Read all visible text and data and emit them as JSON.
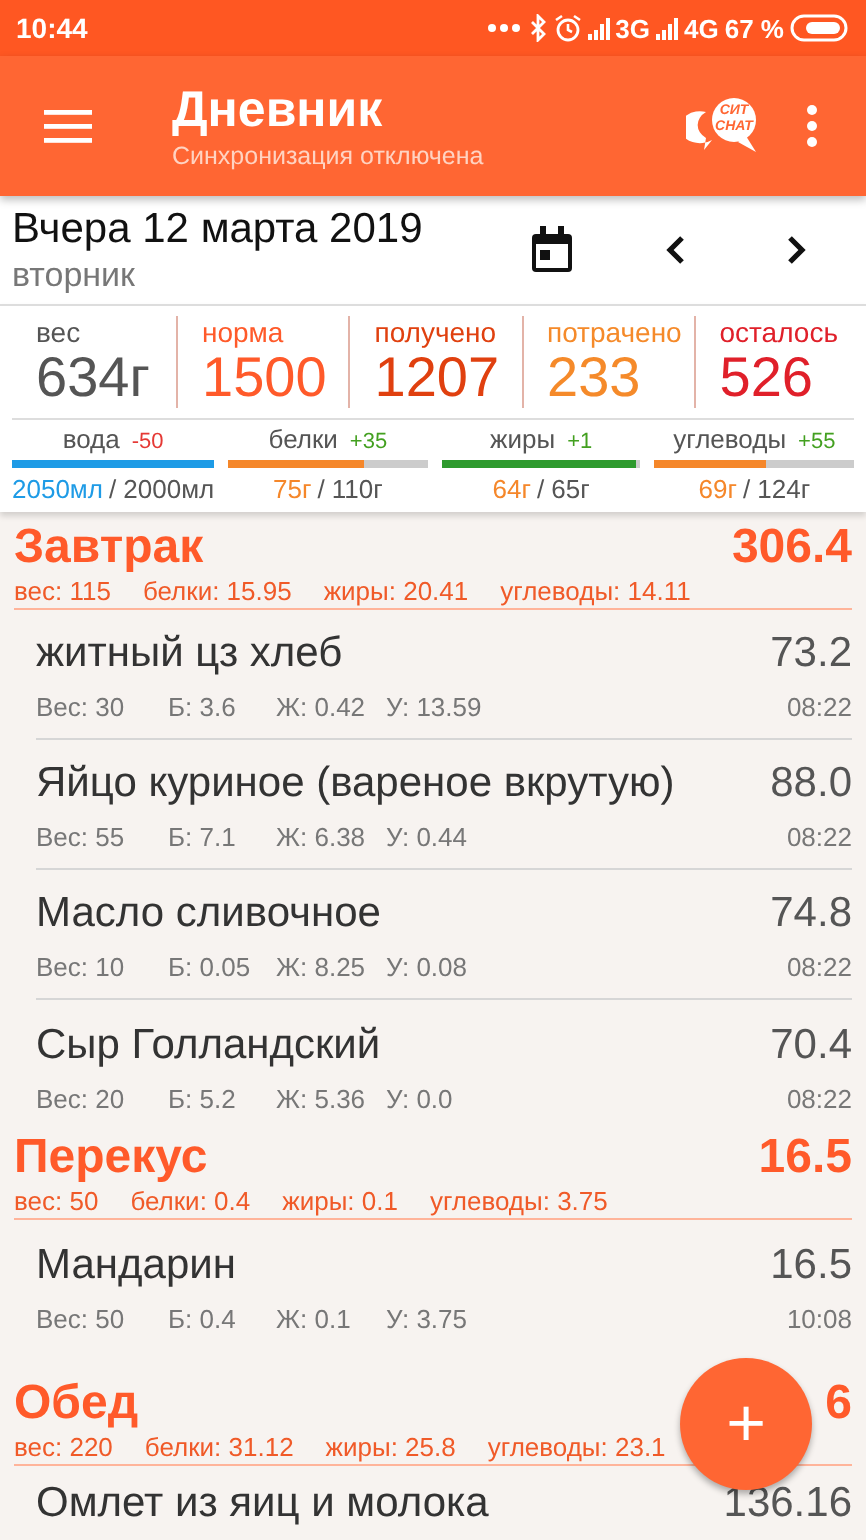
{
  "status_bar": {
    "time": "10:44",
    "network_1": "3G",
    "network_2": "4G",
    "battery": "67 %"
  },
  "app_bar": {
    "title": "Дневник",
    "subtitle": "Синхронизация отключена",
    "chat_badge": [
      "СИТ",
      "CHAT"
    ]
  },
  "date": {
    "title": "Вчера 12 марта 2019",
    "weekday": "вторник"
  },
  "summary": [
    {
      "label": "вес",
      "value": "634г",
      "color": "#555555"
    },
    {
      "label": "норма",
      "value": "1500",
      "color": "#ff5a2a"
    },
    {
      "label": "получено",
      "value": "1207",
      "color": "#e0400f"
    },
    {
      "label": "потрачено",
      "value": "233",
      "color": "#f58a2a"
    },
    {
      "label": "осталось",
      "value": "526",
      "color": "#e0202a"
    }
  ],
  "nutrients": [
    {
      "label": "вода",
      "delta": {
        "text": "-50",
        "color": "#e53935"
      },
      "current": "2050мл",
      "target": "/ 2000мл",
      "level": 1,
      "color": "#1e9be6"
    },
    {
      "label": "белки",
      "delta": {
        "text": "+35",
        "color": "#43a020"
      },
      "current": "75г",
      "target": "/ 110г",
      "level": 0.68,
      "color": "#f5872a"
    },
    {
      "label": "жиры",
      "delta": {
        "text": "+1",
        "color": "#43a020"
      },
      "current": "64г",
      "target": "/ 65г",
      "level": 0.98,
      "color": "#2e9a2e"
    },
    {
      "label": "углеводы",
      "delta": {
        "text": "+55",
        "color": "#43a020"
      },
      "current": "69г",
      "target": "/ 124г",
      "level": 0.56,
      "color": "#f5872a"
    }
  ],
  "meals": [
    {
      "title": "Завтрак",
      "total": "306.4",
      "stats": [
        "вес: 115",
        "белки: 15.95",
        "жиры: 20.41",
        "углеводы: 14.11"
      ],
      "items": [
        {
          "name": "житный цз хлеб",
          "value": "73.2",
          "macros": [
            "Вес: 30",
            "Б: 3.6",
            "Ж: 0.42",
            "У: 13.59"
          ],
          "time": "08:22"
        },
        {
          "name": "Яйцо куриное (вареное вкрутую)",
          "value": "88.0",
          "macros": [
            "Вес: 55",
            "Б: 7.1",
            "Ж: 6.38",
            "У: 0.44"
          ],
          "time": "08:22"
        },
        {
          "name": "Масло сливочное",
          "value": "74.8",
          "macros": [
            "Вес: 10",
            "Б: 0.05",
            "Ж: 8.25",
            "У: 0.08"
          ],
          "time": "08:22"
        },
        {
          "name": "Сыр Голландский",
          "value": "70.4",
          "macros": [
            "Вес: 20",
            "Б: 5.2",
            "Ж: 5.36",
            "У: 0.0"
          ],
          "time": "08:22"
        }
      ]
    },
    {
      "title": "Перекус",
      "total": "16.5",
      "stats": [
        "вес: 50",
        "белки: 0.4",
        "жиры: 0.1",
        "углеводы: 3.75"
      ],
      "items": [
        {
          "name": "Мандарин",
          "value": "16.5",
          "macros": [
            "Вес: 50",
            "Б: 0.4",
            "Ж: 0.1",
            "У: 3.75"
          ],
          "time": "10:08"
        }
      ]
    },
    {
      "title": "Обед",
      "total": "6",
      "stats": [
        "вес: 220",
        "белки: 31.12",
        "жиры: 25.8",
        "углеводы: 23.1"
      ],
      "items": [
        {
          "name": "Омлет из яиц и молока",
          "value": "136.16"
        }
      ]
    }
  ],
  "fab": {
    "label": "+"
  }
}
